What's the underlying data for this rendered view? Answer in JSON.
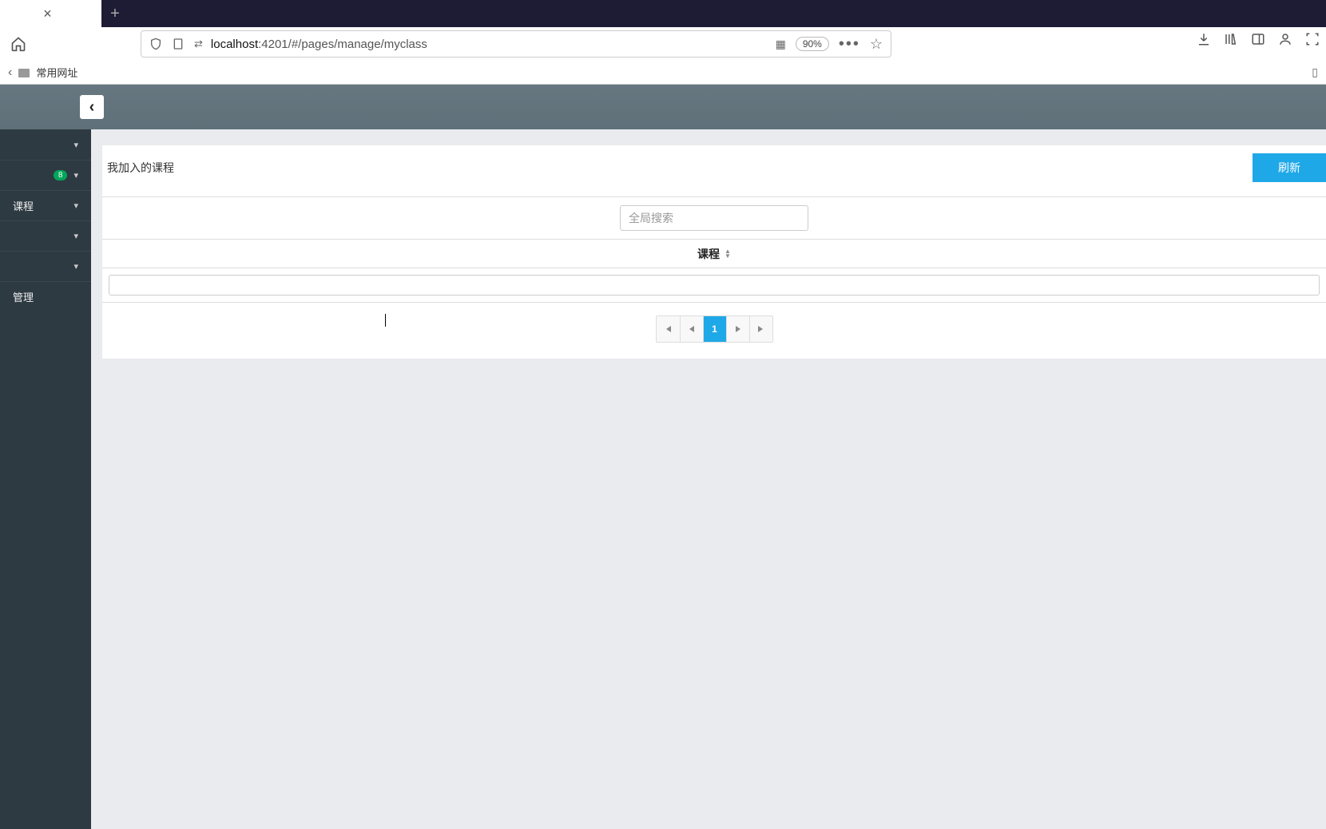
{
  "browser": {
    "close_x": "×",
    "new_tab": "+",
    "url_host": "localhost",
    "url_port_path": ":4201/#/pages/manage/myclass",
    "zoom": "90%",
    "dots": "•••",
    "star": "☆"
  },
  "bookmarks": {
    "folder_label": "常用网址"
  },
  "sidebar": {
    "items": [
      {
        "label": "",
        "badge": "",
        "chevron": "▾"
      },
      {
        "label": "",
        "badge": "8",
        "chevron": "▾"
      },
      {
        "label": "课程",
        "badge": "",
        "chevron": "▾"
      },
      {
        "label": "",
        "badge": "",
        "chevron": "▾"
      },
      {
        "label": "",
        "badge": "",
        "chevron": "▾"
      },
      {
        "label": "管理",
        "badge": "",
        "chevron": ""
      }
    ]
  },
  "app": {
    "collapse_glyph": "‹"
  },
  "page": {
    "title": "我加入的课程",
    "refresh_label": "刷新",
    "search_placeholder": "全局搜索",
    "column_header": "课程",
    "pagination": {
      "first": "⏮",
      "prev": "◀",
      "current": "1",
      "next": "▶",
      "last": "⏭"
    }
  }
}
